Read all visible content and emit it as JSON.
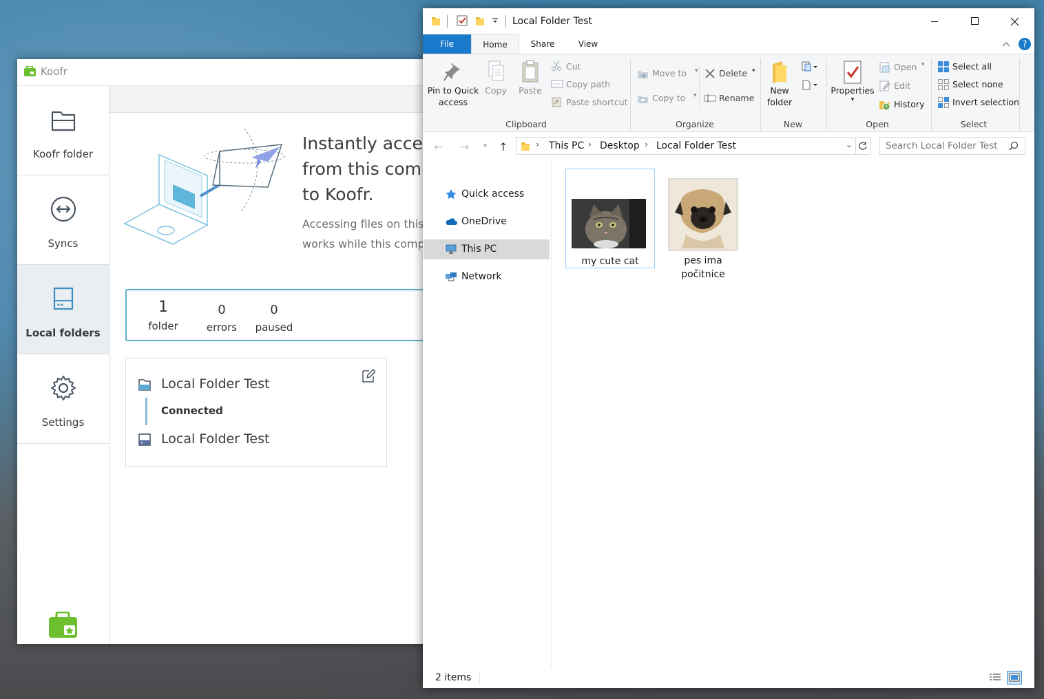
{
  "koofr": {
    "app_title": "Koofr",
    "sidebar": {
      "items": [
        {
          "label": "Koofr folder",
          "icon": "folder-icon"
        },
        {
          "label": "Syncs",
          "icon": "sync-arrows-icon"
        },
        {
          "label": "Local folders",
          "icon": "hard-drive-icon",
          "active": true
        },
        {
          "label": "Settings",
          "icon": "gear-icon"
        }
      ]
    },
    "hero": {
      "title": "Instantly access\nfrom this comp\nto Koofr.",
      "subtitle": "Accessing files on this c\nworks while this compu"
    },
    "stats": {
      "folders_count": "1",
      "folders_label": "folder",
      "errors_count": "0",
      "errors_label": "errors",
      "paused_count": "0",
      "paused_label": "paused"
    },
    "folder_card": {
      "source_name": "Local Folder Test",
      "status": "Connected",
      "target_name": "Local Folder Test"
    },
    "colors": {
      "accent": "#5eaed0",
      "brand_green": "#6cbf2e"
    }
  },
  "explorer": {
    "window_title": "Local Folder Test",
    "tabs": {
      "file": "File",
      "home": "Home",
      "share": "Share",
      "view": "View"
    },
    "ribbon": {
      "clipboard": {
        "group_label": "Clipboard",
        "pin_label": "Pin to Quick\naccess",
        "copy_label": "Copy",
        "paste_label": "Paste",
        "cut_label": "Cut",
        "copy_path_label": "Copy path",
        "paste_shortcut_label": "Paste shortcut"
      },
      "organize": {
        "group_label": "Organize",
        "move_to_label": "Move to",
        "copy_to_label": "Copy to",
        "delete_label": "Delete",
        "rename_label": "Rename"
      },
      "new": {
        "group_label": "New",
        "new_folder_label": "New\nfolder"
      },
      "open": {
        "group_label": "Open",
        "properties_label": "Properties",
        "open_label": "Open",
        "edit_label": "Edit",
        "history_label": "History"
      },
      "select": {
        "group_label": "Select",
        "select_all_label": "Select all",
        "select_none_label": "Select none",
        "invert_selection_label": "Invert selection"
      }
    },
    "address": {
      "crumbs": [
        "This PC",
        "Desktop",
        "Local Folder Test"
      ]
    },
    "search": {
      "placeholder": "Search Local Folder Test"
    },
    "nav_pane": {
      "items": [
        {
          "label": "Quick access",
          "icon": "star-icon"
        },
        {
          "label": "OneDrive",
          "icon": "cloud-icon"
        },
        {
          "label": "This PC",
          "icon": "computer-icon",
          "selected": true
        },
        {
          "label": "Network",
          "icon": "network-icon"
        }
      ]
    },
    "files": [
      {
        "name": "my cute cat",
        "type": "image",
        "selected": true
      },
      {
        "name": "pes ima\npočitnice",
        "type": "image",
        "selected": false
      }
    ],
    "status": {
      "item_count": "2 items"
    }
  }
}
